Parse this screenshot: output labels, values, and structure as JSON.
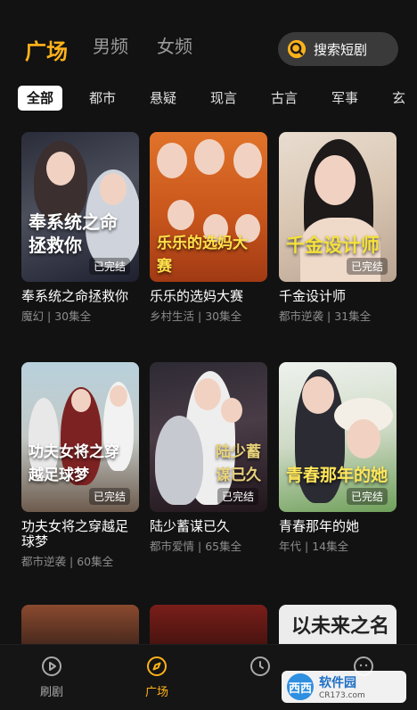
{
  "top_tabs": [
    "广场",
    "男频",
    "女频"
  ],
  "search": {
    "label": "搜索短剧"
  },
  "categories": [
    "全部",
    "都市",
    "悬疑",
    "现言",
    "古言",
    "军事",
    "玄幻"
  ],
  "cards": [
    {
      "title": "奉系统之命拯救你",
      "genre": "魔幻",
      "episodes": "30集全",
      "poster_text": "奉系统之命拯救你",
      "badge": "已完结"
    },
    {
      "title": "乐乐的选妈大赛",
      "genre": "乡村生活",
      "episodes": "30集全",
      "poster_text": "乐乐的选妈大赛",
      "badge": ""
    },
    {
      "title": "千金设计师",
      "genre": "都市逆袭",
      "episodes": "31集全",
      "poster_text": "千金设计师",
      "badge": "已完结"
    },
    {
      "title": "功夫女将之穿越足球梦",
      "genre": "都市逆袭",
      "episodes": "60集全",
      "poster_text": "功夫女将之穿越足球梦",
      "badge": "已完结"
    },
    {
      "title": "陆少蓄谋已久",
      "genre": "都市爱情",
      "episodes": "65集全",
      "poster_text": "陆少蓄谋已久",
      "badge": "已完结"
    },
    {
      "title": "青春那年的她",
      "genre": "年代",
      "episodes": "14集全",
      "poster_text": "青春那年的她",
      "badge": "已完结"
    }
  ],
  "partial_cards": {
    "third_poster_text": "以未来之名"
  },
  "bottom_nav": [
    "刷剧",
    "广场",
    "",
    ""
  ],
  "watermark": {
    "logo": "西西",
    "text": "软件园",
    "sub": "CR173.com"
  },
  "colors": {
    "accent": "#ffb21a",
    "background": "#121212",
    "card_meta": "#8c8c8c"
  }
}
